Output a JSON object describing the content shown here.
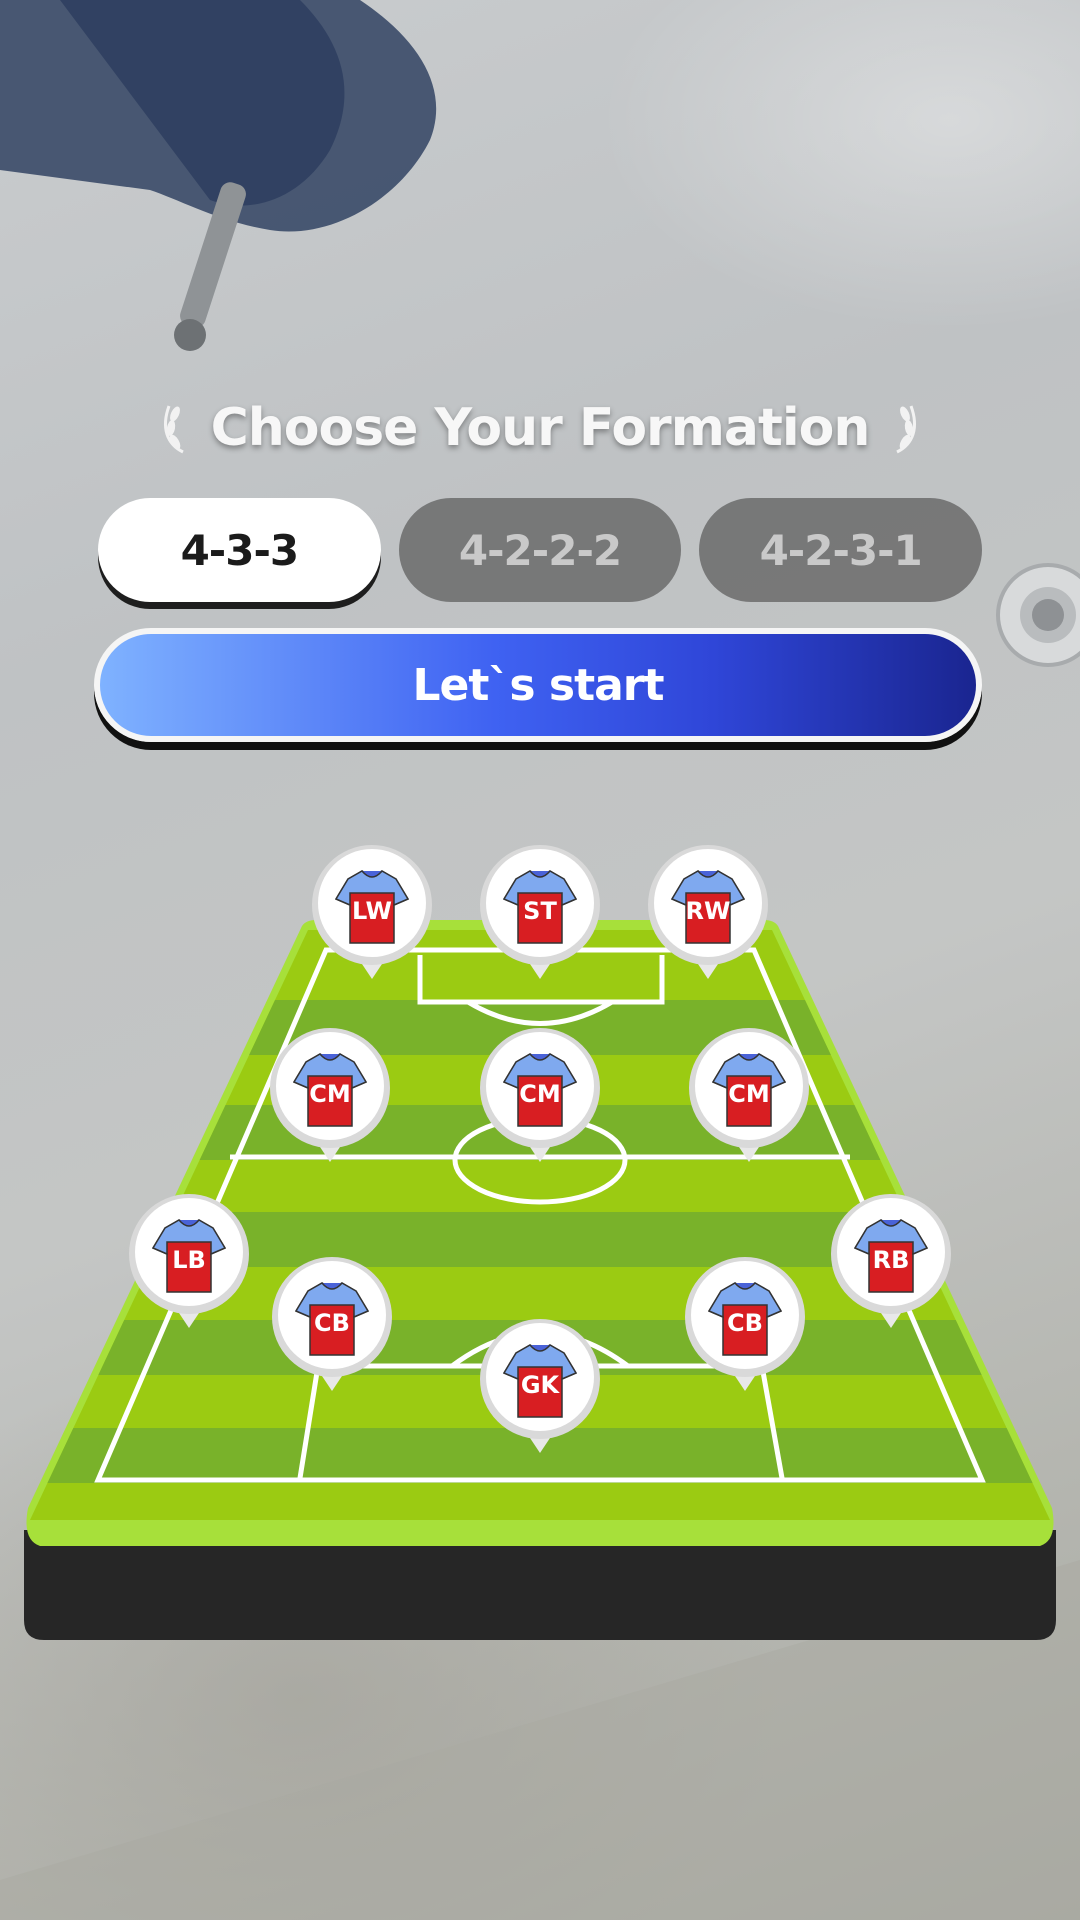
{
  "title": "Choose Your Formation",
  "formations": [
    {
      "label": "4-3-3",
      "selected": true
    },
    {
      "label": "4-2-2-2",
      "selected": false
    },
    {
      "label": "4-2-3-1",
      "selected": false
    }
  ],
  "start_button": "Let`s start",
  "players": [
    "LW",
    "ST",
    "RW",
    "CM",
    "CM",
    "CM",
    "LB",
    "RB",
    "CB",
    "CB",
    "GK"
  ],
  "colors": {
    "pitch_light": "#9bcb12",
    "pitch_dark": "#79b22a",
    "shirt_red": "#d81e22",
    "shirt_sleeve": "#7fa9ef",
    "button_blue": "#2f46d8",
    "tab_active": "#ffffff",
    "tab_inactive": "#6a6a6a"
  }
}
